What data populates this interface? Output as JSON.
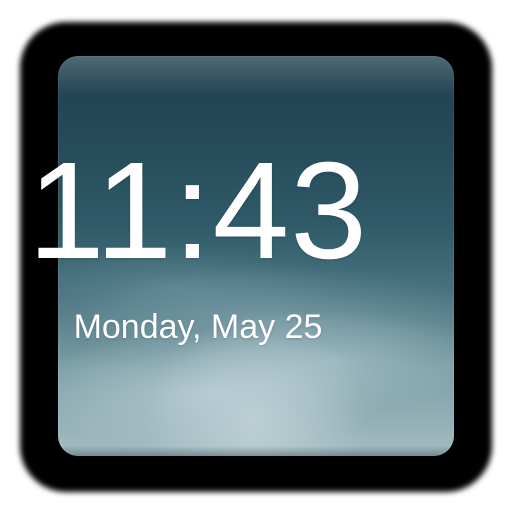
{
  "clock": {
    "time": "11:43",
    "date": "Monday, May 25"
  }
}
